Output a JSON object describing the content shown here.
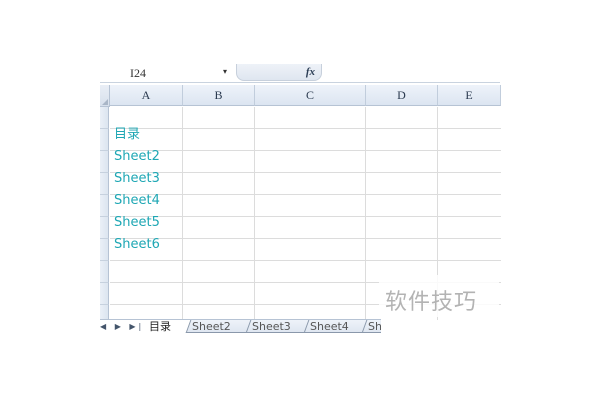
{
  "formula_bar": {
    "name_box": "I24",
    "dropdown_icon": "triangle-down-icon",
    "fx_label": "fx"
  },
  "columns": [
    "A",
    "B",
    "C",
    "D",
    "E"
  ],
  "cells": {
    "a2": "目录",
    "a3": "Sheet2",
    "a4": "Sheet3",
    "a5": "Sheet4",
    "a6": "Sheet5",
    "a7": "Sheet6"
  },
  "link_color": "#1ea7b4",
  "sheet_tabs": {
    "nav_icons": "◀ ▶ ▶|",
    "active": "目录",
    "tab1": "Sheet2",
    "tab2": "Sheet3",
    "tab3": "Sheet4",
    "tab4": "Sh"
  },
  "watermark": "软件技巧"
}
